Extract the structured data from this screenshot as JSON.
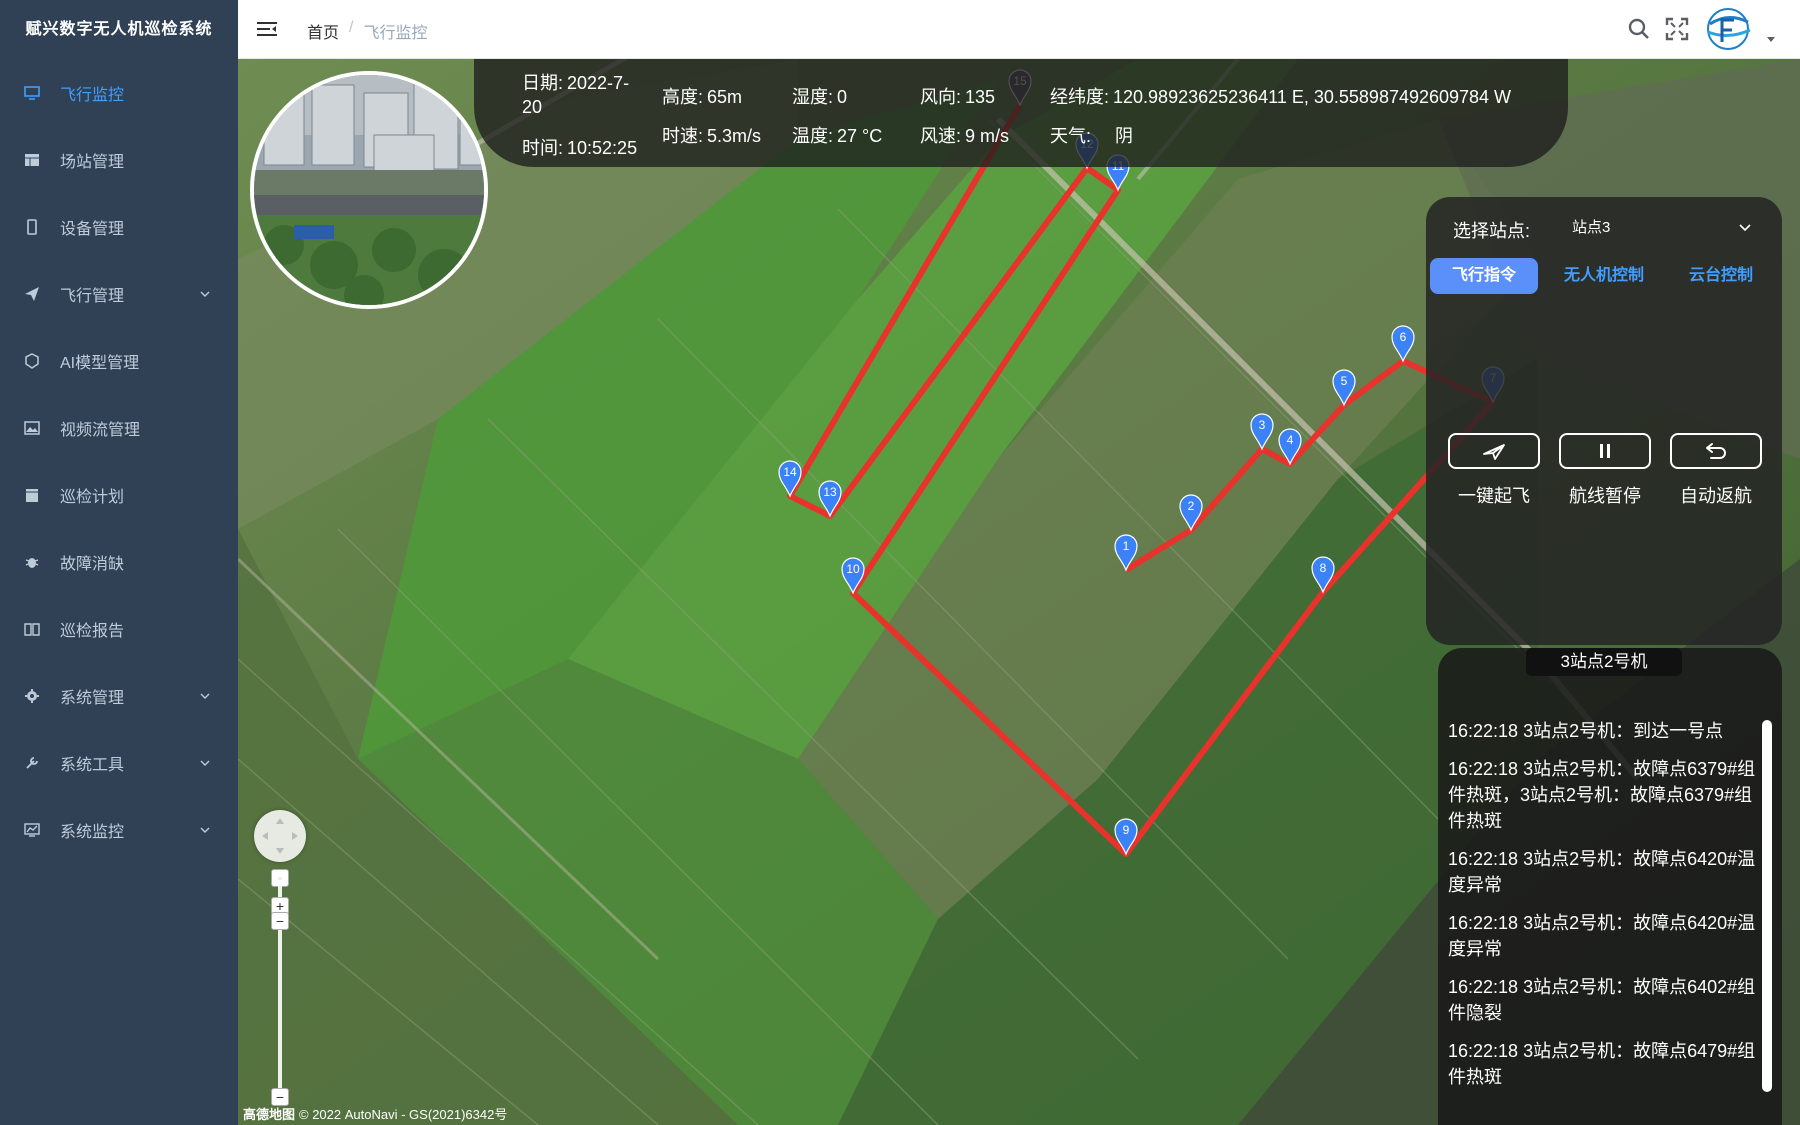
{
  "app": {
    "title": "赋兴数字无人机巡检系统"
  },
  "sidebar": {
    "items": [
      {
        "label": "飞行监控",
        "icon": "monitor-icon",
        "active": true,
        "has_arrow": false
      },
      {
        "label": "场站管理",
        "icon": "table-icon",
        "active": false,
        "has_arrow": false
      },
      {
        "label": "设备管理",
        "icon": "phone-icon",
        "active": false,
        "has_arrow": false
      },
      {
        "label": "飞行管理",
        "icon": "paper-plane-icon",
        "active": false,
        "has_arrow": true
      },
      {
        "label": "AI模型管理",
        "icon": "cube-icon",
        "active": false,
        "has_arrow": false
      },
      {
        "label": "视频流管理",
        "icon": "image-icon",
        "active": false,
        "has_arrow": false
      },
      {
        "label": "巡检计划",
        "icon": "calendar-icon",
        "active": false,
        "has_arrow": false
      },
      {
        "label": "故障消缺",
        "icon": "bug-icon",
        "active": false,
        "has_arrow": false
      },
      {
        "label": "巡检报告",
        "icon": "book-icon",
        "active": false,
        "has_arrow": false
      },
      {
        "label": "系统管理",
        "icon": "gear-icon",
        "active": false,
        "has_arrow": true
      },
      {
        "label": "系统工具",
        "icon": "tool-icon",
        "active": false,
        "has_arrow": true
      },
      {
        "label": "系统监控",
        "icon": "chart-icon",
        "active": false,
        "has_arrow": true
      }
    ]
  },
  "header": {
    "breadcrumb": {
      "home": "首页",
      "separator": "/",
      "current": "飞行监控"
    }
  },
  "info": {
    "date_label": "日期:",
    "date_value": "2022-7-20",
    "time_label": "时间:",
    "time_value": "10:52:25",
    "height_label": "高度:",
    "height_value": "65m",
    "speed_label": "时速:",
    "speed_value": "5.3m/s",
    "humidity_label": "湿度:",
    "humidity_value": "0",
    "temp_label": "温度:",
    "temp_value": "27 °C",
    "wind_dir_label": "风向:",
    "wind_dir_value": "135",
    "wind_speed_label": "风速:",
    "wind_speed_value": "9 m/s",
    "coord_label": "经纬度:",
    "coord_value": "120.98923625236411 E, 30.558987492609784 W",
    "weather_label": "天气:",
    "weather_value": "阴"
  },
  "control": {
    "site_label": "选择站点:",
    "site_value": "站点3",
    "tabs": [
      "飞行指令",
      "无人机控制",
      "云台控制"
    ],
    "actions": [
      {
        "label": "一键起飞",
        "icon": "takeoff-icon"
      },
      {
        "label": "航线暂停",
        "icon": "pause-icon"
      },
      {
        "label": "自动返航",
        "icon": "return-icon"
      }
    ]
  },
  "log": {
    "title": "3站点2号机",
    "entries": [
      "16:22:18 3站点2号机：到达一号点",
      "16:22:18 3站点2号机：故障点6379#组件热斑，3站点2号机：故障点6379#组件热斑",
      "16:22:18 3站点2号机：故障点6420#温度异常",
      "16:22:18 3站点2号机：故障点6420#温度异常",
      "16:22:18 3站点2号机：故障点6402#组件隐裂",
      "16:22:18 3站点2号机：故障点6479#组件热斑"
    ]
  },
  "map": {
    "waypoint_labels": [
      "1",
      "2",
      "3",
      "4",
      "5",
      "6",
      "7",
      "8",
      "9",
      "10",
      "11",
      "12",
      "13",
      "14",
      "15"
    ],
    "attribution": "© 2022 AutoNavi - GS(2021)6342号",
    "logo_text": "高德地图",
    "route_color": "#e8322c",
    "marker_color": "#3b82f6"
  },
  "colors": {
    "sidebar_bg": "#304156",
    "accent": "#409eff",
    "tab_active": "#5b8ff9"
  }
}
